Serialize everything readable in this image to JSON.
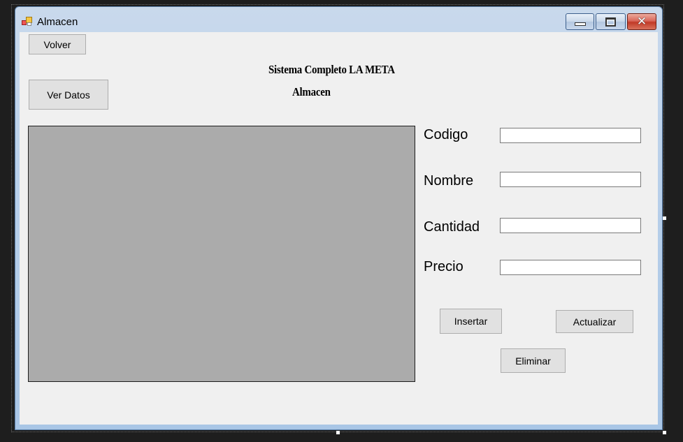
{
  "window": {
    "title": "Almacen"
  },
  "toolbar": {
    "back_label": "Volver",
    "view_data_label": "Ver Datos"
  },
  "header": {
    "line1": "Sistema Completo LA META",
    "line2": "Almacen"
  },
  "form": {
    "codigo": {
      "label": "Codigo",
      "value": ""
    },
    "nombre": {
      "label": "Nombre",
      "value": ""
    },
    "cantidad": {
      "label": "Cantidad",
      "value": ""
    },
    "precio": {
      "label": "Precio",
      "value": ""
    }
  },
  "actions": {
    "insert_label": "Insertar",
    "update_label": "Actualizar",
    "delete_label": "Eliminar"
  },
  "icons": {
    "app": "form-icon",
    "minimize": "minimize-icon",
    "maximize": "maximize-icon",
    "close": "close-icon"
  },
  "colors": {
    "client_background": "#f0f0f0",
    "grid_background": "#ababab",
    "close_button": "#c13a27"
  }
}
